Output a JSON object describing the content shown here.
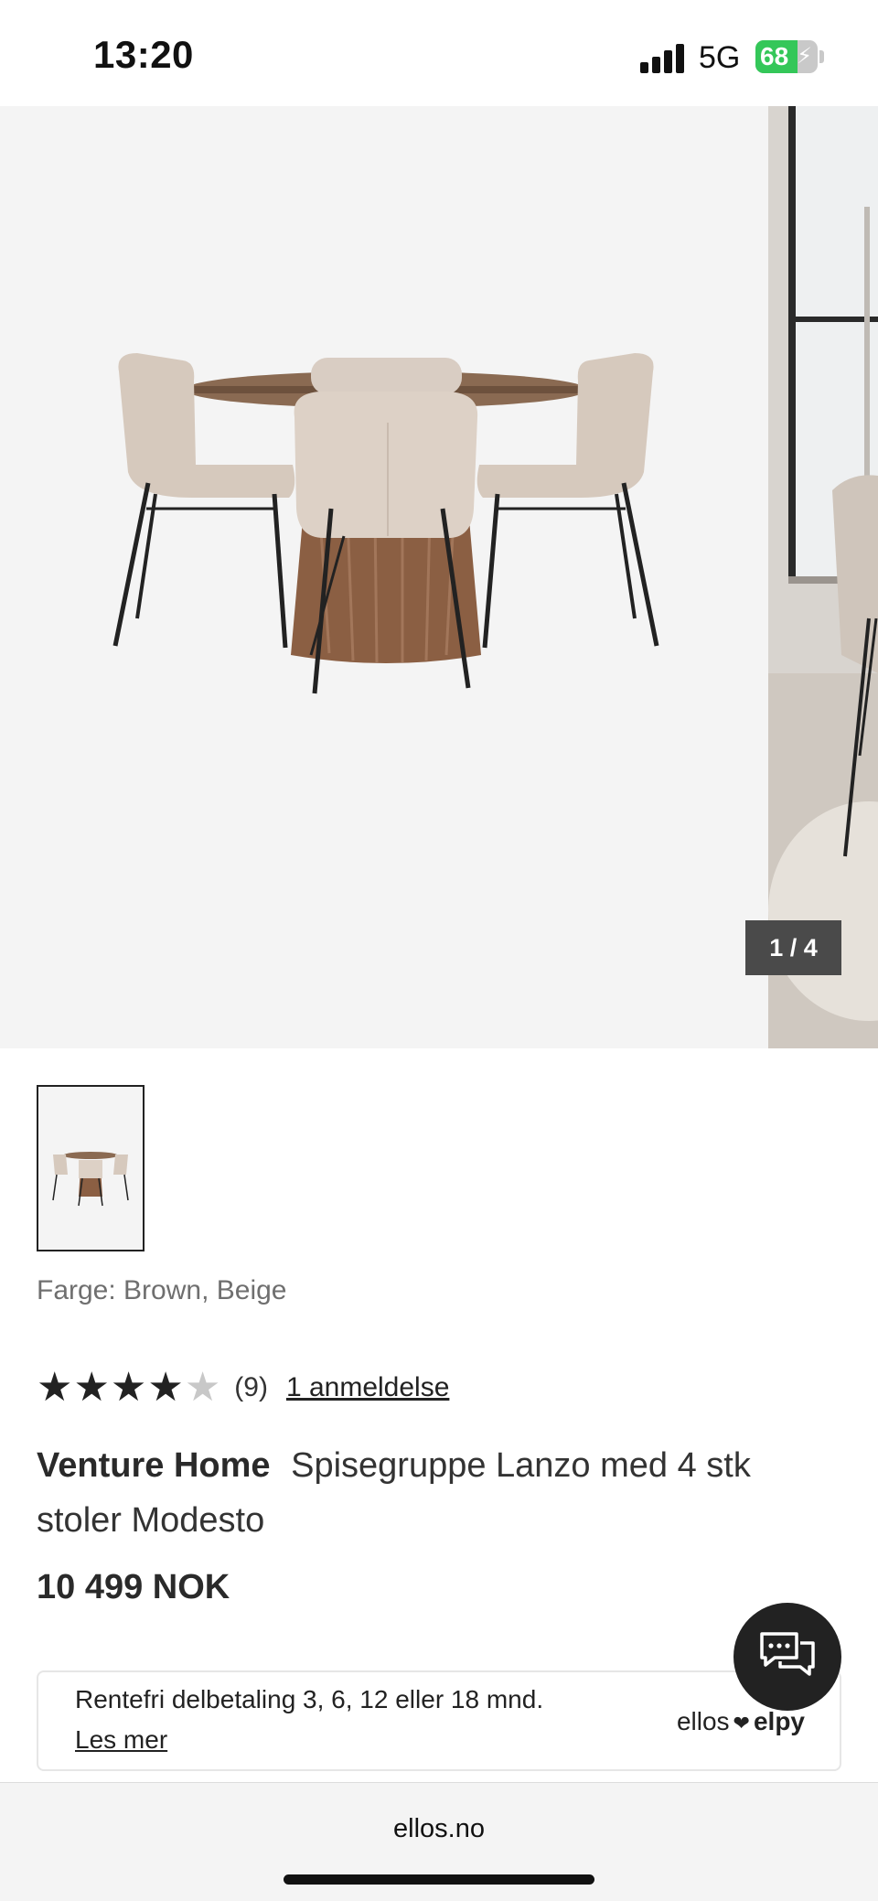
{
  "status_bar": {
    "time": "13:20",
    "network": "5G",
    "battery_level": "68",
    "battery_percent": 68,
    "battery_charging": true
  },
  "gallery": {
    "counter": "1 / 4",
    "current_index": 1,
    "total_images": 4
  },
  "product": {
    "color_label": "Farge: Brown, Beige",
    "rating_value": 4,
    "rating_max": 5,
    "rating_count": "(9)",
    "reviews_link": "1 anmeldelse",
    "brand": "Venture Home",
    "name": "Spisegruppe Lanzo med 4 stk stoler Modesto",
    "price": "10 499 NOK"
  },
  "financing": {
    "text": "Rentefri delbetaling 3, 6, 12 eller 18 mnd.",
    "link": "Les mer",
    "partner_left": "ellos",
    "partner_right": "elpy"
  },
  "browser": {
    "url": "ellos.no"
  },
  "colors": {
    "battery_green": "#34c759",
    "counter_bg": "#4a4a4a",
    "chat_bg": "#222222",
    "text_primary": "#222222",
    "text_muted": "#6f6f6f"
  },
  "icons": [
    "signal-icon",
    "battery-icon",
    "star-icon",
    "chat-icon",
    "heart-icon"
  ]
}
